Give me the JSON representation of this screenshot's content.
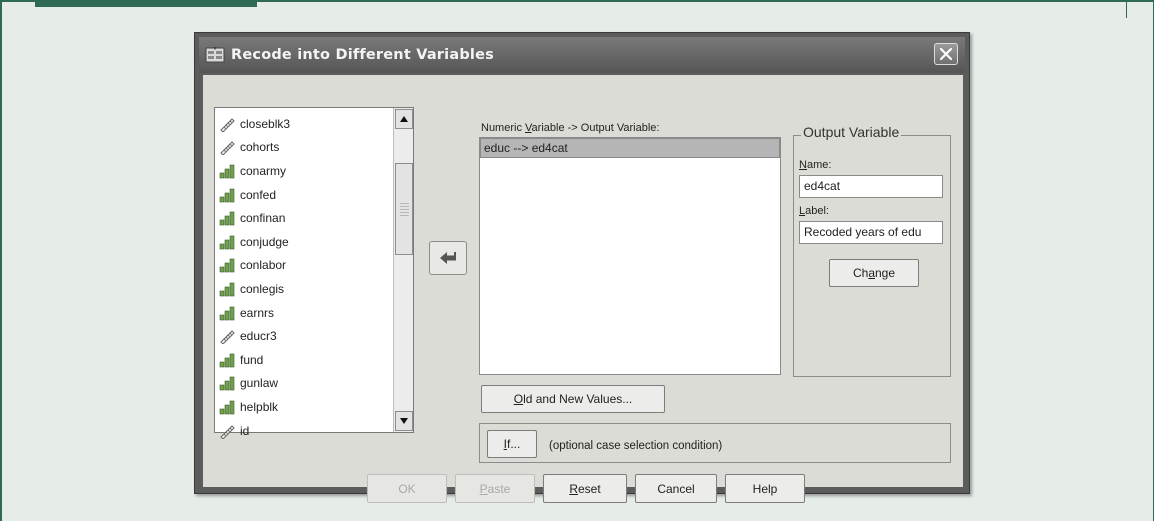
{
  "window": {
    "title": "Recode into Different Variables",
    "close_icon": "close-icon"
  },
  "variables": [
    {
      "name": "closeblk3",
      "icon": "ruler-icon"
    },
    {
      "name": "cohorts",
      "icon": "ruler-icon"
    },
    {
      "name": "conarmy",
      "icon": "bar-chart-icon"
    },
    {
      "name": "confed",
      "icon": "bar-chart-icon"
    },
    {
      "name": "confinan",
      "icon": "bar-chart-icon"
    },
    {
      "name": "conjudge",
      "icon": "bar-chart-icon"
    },
    {
      "name": "conlabor",
      "icon": "bar-chart-icon"
    },
    {
      "name": "conlegis",
      "icon": "bar-chart-icon"
    },
    {
      "name": "earnrs",
      "icon": "bar-chart-icon"
    },
    {
      "name": "educr3",
      "icon": "ruler-icon"
    },
    {
      "name": "fund",
      "icon": "bar-chart-icon"
    },
    {
      "name": "gunlaw",
      "icon": "bar-chart-icon"
    },
    {
      "name": "helpblk",
      "icon": "bar-chart-icon"
    },
    {
      "name": "id",
      "icon": "ruler-icon"
    }
  ],
  "mapping": {
    "label": "Numeric Variable -> Output Variable:",
    "rows": [
      "educ --> ed4cat"
    ]
  },
  "output_variable": {
    "group_title": "Output Variable",
    "name_label": "Name:",
    "name_value": "ed4cat",
    "label_label": "Label:",
    "label_value": "Recoded years of edu",
    "change_button": "Change"
  },
  "old_new_button": "Old and New Values...",
  "if_button": "If...",
  "if_caption": "(optional case selection condition)",
  "footer_buttons": {
    "ok": "OK",
    "paste": "Paste",
    "reset": "Reset",
    "cancel": "Cancel",
    "help": "Help"
  }
}
